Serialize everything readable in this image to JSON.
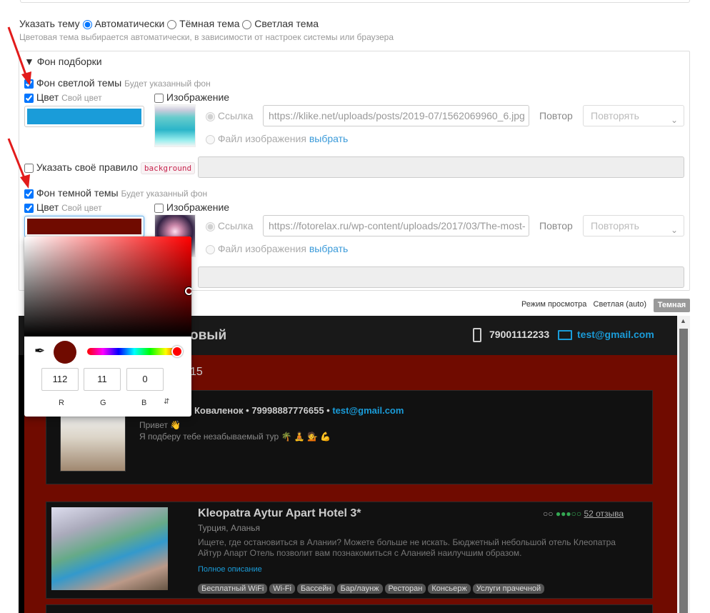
{
  "theme": {
    "label": "Указать тему",
    "options": [
      "Автоматически",
      "Тёмная тема",
      "Светлая тема"
    ],
    "selected": 0,
    "hint": "Цветовая тема выбирается автоматически, в зависимости от настроек системы или браузера"
  },
  "collection_bg": {
    "legend": "▼ Фон подборки",
    "light": {
      "label": "Фон светлой темы",
      "hint": "Будет указанный фон",
      "checked": true,
      "color_label": "Цвет",
      "color_hint": "Свой цвет",
      "color_value": "#1a9cd9",
      "image_label": "Изображение",
      "link_label": "Ссылка",
      "link_value": "https://klike.net/uploads/posts/2019-07/1562069960_6.jpg",
      "file_label": "Файл изображения",
      "file_link": "выбрать",
      "repeat_label": "Повтор",
      "repeat_value": "Повторять"
    },
    "custom_rule": {
      "label": "Указать своё правило",
      "code": "background"
    },
    "dark": {
      "label": "Фон темной темы",
      "hint": "Будет указанный фон",
      "checked": true,
      "color_label": "Цвет",
      "color_hint": "Свой цвет",
      "color_value": "#700b00",
      "image_label": "Изображение",
      "link_label": "Ссылка",
      "link_value": "https://fotorelax.ru/wp-content/uploads/2017/03/The-most-",
      "file_label": "Файл изображения",
      "file_link": "выбрать",
      "repeat_label": "Повтор",
      "repeat_value": "Повторять"
    }
  },
  "picker": {
    "r": "112",
    "g": "11",
    "b": "0",
    "r_label": "R",
    "g_label": "G",
    "b_label": "B",
    "swatch_color": "#700b00"
  },
  "view_mode": {
    "label": "Режим просмотра",
    "light": "Светлая (auto)",
    "dark": "Темная"
  },
  "preview": {
    "title_fragment": "овый",
    "phone": "79001112233",
    "email": "test@gmail.com",
    "date_fragment": "15",
    "agent": {
      "name_fragment": "Коваленок",
      "phone": "79998887776655",
      "email": "test@gmail.com",
      "greeting": "Привет 👋",
      "message": "Я подберу тебе незабываемый тур 🌴 🧘 💁 💪"
    },
    "hotel": {
      "name": "Kleopatra Aytur Apart Hotel 3*",
      "location": "Турция, Аланья",
      "description": "Ищете, где остановиться в Алании? Можете больше не искать. Бюджетный небольшой отель Клеопатра Айтур Апарт Отель позволит вам познакомиться с Аланией наилучшим образом.",
      "more_link": "Полное описание",
      "reviews": "52 отзыва",
      "rating": 3,
      "amenities": [
        "Бесплатный WiFi",
        "Wi-Fi",
        "Бассейн",
        "Бар/лаунж",
        "Ресторан",
        "Консьерж",
        "Услуги прачечной"
      ]
    }
  },
  "colors": {
    "accent_blue": "#1a9cd9",
    "dark_red": "#700b00",
    "arrow_red": "#e21b1b",
    "link": "#3a9ad9",
    "ta_green": "#34a853"
  }
}
